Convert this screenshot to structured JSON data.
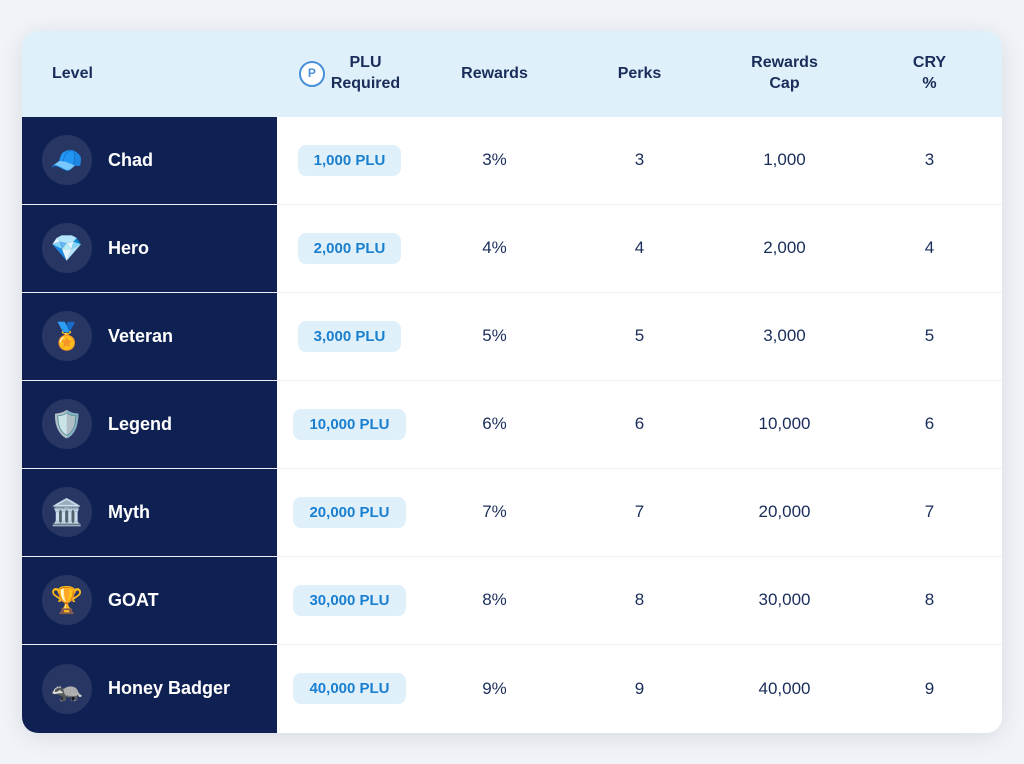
{
  "header": {
    "level_label": "Level",
    "plu_label": "PLU\nRequired",
    "rewards_label": "Rewards",
    "perks_label": "Perks",
    "rewards_cap_label": "Rewards Cap",
    "cry_label": "CRY %"
  },
  "rows": [
    {
      "name": "Chad",
      "icon": "🧢",
      "plu": "1,000 PLU",
      "rewards": "3%",
      "perks": "3",
      "rewards_cap": "1,000",
      "cry": "3"
    },
    {
      "name": "Hero",
      "icon": "💎",
      "plu": "2,000 PLU",
      "rewards": "4%",
      "perks": "4",
      "rewards_cap": "2,000",
      "cry": "4"
    },
    {
      "name": "Veteran",
      "icon": "🏅",
      "plu": "3,000 PLU",
      "rewards": "5%",
      "perks": "5",
      "rewards_cap": "3,000",
      "cry": "5"
    },
    {
      "name": "Legend",
      "icon": "🛡️",
      "plu": "10,000 PLU",
      "rewards": "6%",
      "perks": "6",
      "rewards_cap": "10,000",
      "cry": "6"
    },
    {
      "name": "Myth",
      "icon": "🏛️",
      "plu": "20,000 PLU",
      "rewards": "7%",
      "perks": "7",
      "rewards_cap": "20,000",
      "cry": "7"
    },
    {
      "name": "GOAT",
      "icon": "🏆",
      "plu": "30,000 PLU",
      "rewards": "8%",
      "perks": "8",
      "rewards_cap": "30,000",
      "cry": "8"
    },
    {
      "name": "Honey Badger",
      "icon": "🦡",
      "plu": "40,000 PLU",
      "rewards": "9%",
      "perks": "9",
      "rewards_cap": "40,000",
      "cry": "9"
    }
  ]
}
